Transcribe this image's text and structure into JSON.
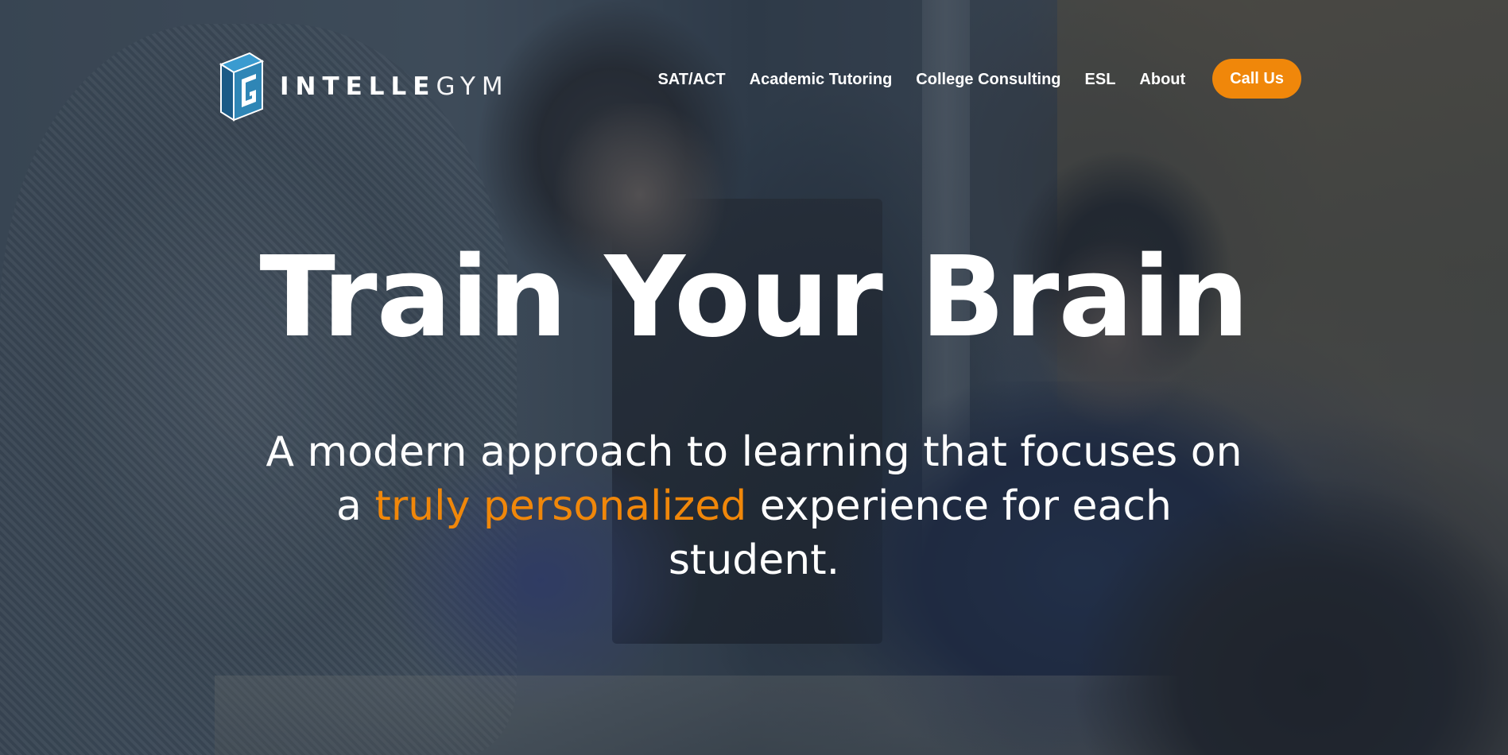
{
  "brand": {
    "name_bold": "INTELLE",
    "name_light": "GYM",
    "logo_icon": "intellegym-cube-logo",
    "colors": {
      "accent": "#f0870a",
      "logo_blue_dark": "#1b5a86",
      "logo_blue_light": "#2f86b6",
      "text": "#ffffff"
    }
  },
  "nav": {
    "items": [
      {
        "label": "SAT/ACT"
      },
      {
        "label": "Academic Tutoring"
      },
      {
        "label": "College Consulting"
      },
      {
        "label": "ESL"
      },
      {
        "label": "About"
      }
    ],
    "cta_label": "Call Us"
  },
  "hero": {
    "headline": "Train Your Brain",
    "subhead": {
      "line1": "A modern approach to learning that focuses on",
      "line2_prefix": "a ",
      "line2_highlight": "truly personalized",
      "line2_suffix": " experience for each",
      "line3": "student."
    }
  }
}
